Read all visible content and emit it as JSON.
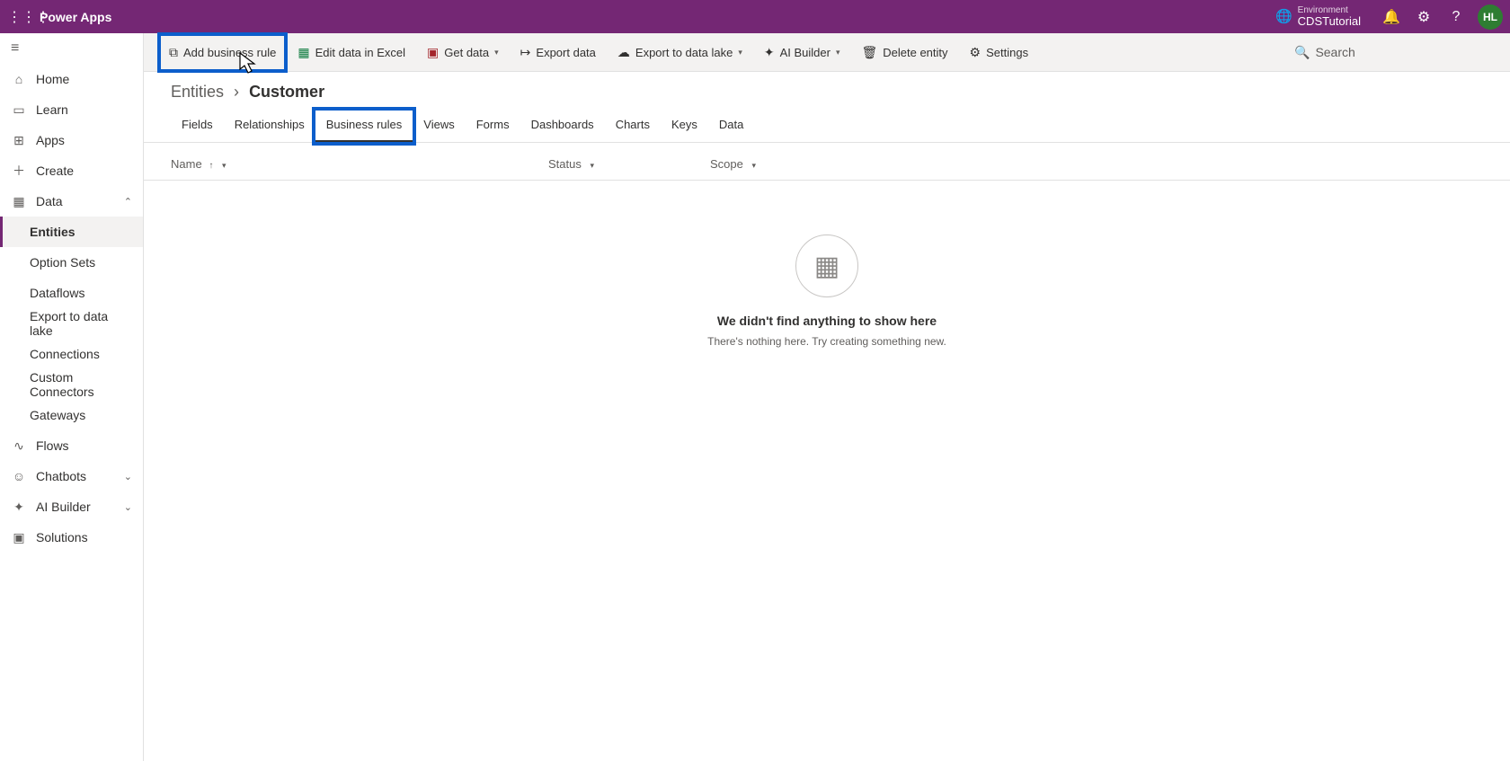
{
  "header": {
    "app_name": "Power Apps",
    "env_label": "Environment",
    "env_value": "CDSTutorial",
    "avatar_initials": "HL"
  },
  "leftnav": {
    "home": "Home",
    "learn": "Learn",
    "apps": "Apps",
    "create": "Create",
    "data": "Data",
    "data_children": {
      "entities": "Entities",
      "option_sets": "Option Sets",
      "dataflows": "Dataflows",
      "export_lake": "Export to data lake",
      "connections": "Connections",
      "custom_connectors": "Custom Connectors",
      "gateways": "Gateways"
    },
    "flows": "Flows",
    "chatbots": "Chatbots",
    "ai_builder": "AI Builder",
    "solutions": "Solutions"
  },
  "cmdbar": {
    "add_rule": "Add business rule",
    "edit_excel": "Edit data in Excel",
    "get_data": "Get data",
    "export_data": "Export data",
    "export_lake": "Export to data lake",
    "ai_builder": "AI Builder",
    "delete_entity": "Delete entity",
    "settings": "Settings",
    "search_placeholder": "Search"
  },
  "breadcrumb": {
    "parent": "Entities",
    "current": "Customer"
  },
  "tabs": {
    "fields": "Fields",
    "relationships": "Relationships",
    "business_rules": "Business rules",
    "views": "Views",
    "forms": "Forms",
    "dashboards": "Dashboards",
    "charts": "Charts",
    "keys": "Keys",
    "data": "Data"
  },
  "columns": {
    "name": "Name",
    "status": "Status",
    "scope": "Scope"
  },
  "empty": {
    "title": "We didn't find anything to show here",
    "subtitle": "There's nothing here. Try creating something new."
  }
}
